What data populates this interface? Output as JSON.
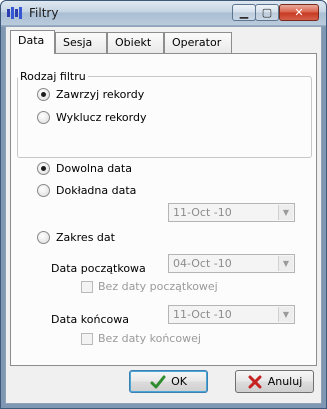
{
  "window": {
    "title": "Filtry"
  },
  "tabs": [
    {
      "label": "Data",
      "active": true
    },
    {
      "label": "Sesja",
      "active": false
    },
    {
      "label": "Obiekt",
      "active": false
    },
    {
      "label": "Operator",
      "active": false
    }
  ],
  "filter_type": {
    "legend": "Rodzaj filtru",
    "options": [
      {
        "label": "Zawrzyj rekordy",
        "checked": true
      },
      {
        "label": "Wyklucz rekordy",
        "checked": false
      }
    ]
  },
  "date_mode": {
    "any": {
      "label": "Dowolna data",
      "checked": true
    },
    "exact": {
      "label": "Dokładna data",
      "checked": false,
      "value": "11-Oct -10"
    },
    "range": {
      "label": "Zakres dat",
      "checked": false
    }
  },
  "range": {
    "start_label": "Data początkowa",
    "start_value": "04-Oct -10",
    "no_start_label": "Bez daty początkowej",
    "end_label": "Data końcowa",
    "end_value": "11-Oct -10",
    "no_end_label": "Bez daty końcowej"
  },
  "buttons": {
    "ok": "OK",
    "cancel": "Anuluj"
  },
  "colors": {
    "ok_check": "#2e8b2e",
    "cancel_x": "#c62020",
    "title_bar": "#b9cadb"
  }
}
